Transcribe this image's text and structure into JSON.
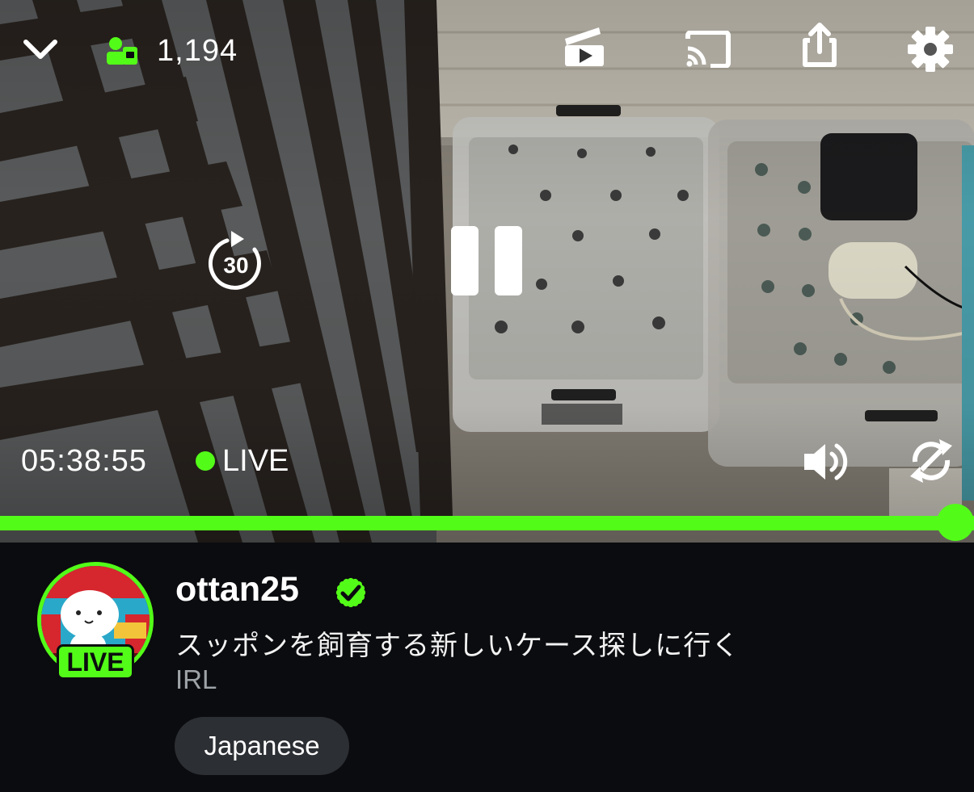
{
  "player": {
    "viewer_count": "1,194",
    "elapsed_time": "05:38:55",
    "live_label": "LIVE",
    "seek_back_seconds": "30",
    "progress_fraction": 1.0,
    "accent_color": "#53fc18",
    "icons": {
      "collapse": "chevron-down-icon",
      "viewers": "viewers-icon",
      "clip": "clip-icon",
      "cast": "cast-icon",
      "share": "share-icon",
      "settings": "gear-icon",
      "rewind": "rewind-30-icon",
      "pause": "pause-icon",
      "volume": "volume-icon",
      "rotate": "rotate-icon"
    }
  },
  "channel": {
    "name": "ottan25",
    "verified": true,
    "avatar_badge": "LIVE",
    "stream_title": "スッポンを飼育する新しいケース探しに行く",
    "category": "IRL",
    "tags": [
      "Japanese"
    ]
  }
}
